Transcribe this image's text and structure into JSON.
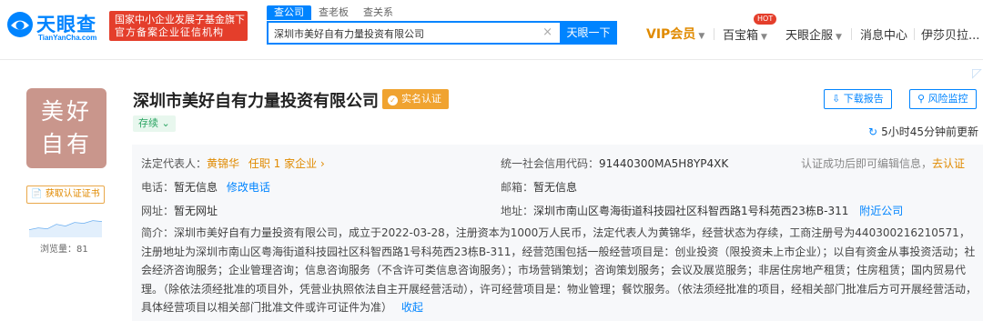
{
  "brand": {
    "name": "天眼查",
    "domain": "TianYanCha.com",
    "badge_line1": "国家中小企业发展子基金旗下",
    "badge_line2": "官方备案企业征信机构"
  },
  "search": {
    "tabs": [
      "查公司",
      "查老板",
      "查关系"
    ],
    "query": "深圳市美好自有力量投资有限公司",
    "button": "天眼一下"
  },
  "nav": {
    "vip": "VIP会员",
    "hot_badge": "HOT",
    "treasure": "百宝箱",
    "enterprise": "天眼企服",
    "messages": "消息中心",
    "user": "伊莎贝拉..."
  },
  "company": {
    "avatar_line1": "美好",
    "avatar_line2": "自有",
    "name": "深圳市美好自有力量投资有限公司",
    "verified": "实名认证",
    "status": "存续",
    "get_cert": "获取认证证书",
    "views": "浏览量：81",
    "download_report": "下载报告",
    "risk_monitor": "风险监控",
    "updated": "5小时45分钟前更新"
  },
  "details": {
    "legal_rep_label": "法定代表人：",
    "legal_rep": "黄锦华",
    "legal_rep_roles": "任职 1 家企业",
    "credit_code_label": "统一社会信用代码：",
    "credit_code": "91440300MA5H8YP4XK",
    "edit_hint": "认证成功后即可编辑信息，",
    "edit_link": "去认证",
    "phone_label": "电话：",
    "phone": "暂无信息",
    "phone_edit": "修改电话",
    "email_label": "邮箱：",
    "email": "暂无信息",
    "website_label": "网址：",
    "website": "暂无网址",
    "address_label": "地址：",
    "address": "深圳市南山区粤海街道科技园社区科智西路1号科苑西23栋B-311",
    "nearby": "附近公司",
    "intro_label": "简介：",
    "intro_text": "深圳市美好自有力量投资有限公司，成立于2022-03-28，注册资本为1000万人民币，法定代表人为黄锦华，经营状态为存续，工商注册号为440300216210571，注册地址为深圳市南山区粤海街道科技园社区科智西路1号科苑西23栋B-311，经营范围包括一般经营项目是：创业投资（限投资未上市企业）；以自有资金从事投资活动；社会经济咨询服务；企业管理咨询；信息咨询服务（不含许可类信息咨询服务）；市场营销策划；咨询策划服务；会议及展览服务；非居住房地产租赁；住房租赁；国内贸易代理。（除依法须经批准的项目外，凭营业执照依法自主开展经营活动），许可经营项目是：物业管理；餐饮服务。（依法须经批准的项目，经相关部门批准后方可开展经营活动，具体经营项目以相关部门批准文件或许可证件为准）",
    "collapse": "收起"
  }
}
